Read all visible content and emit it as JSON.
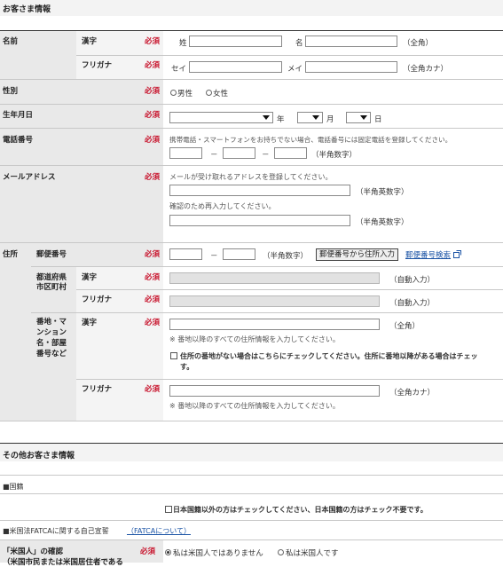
{
  "sections": {
    "customer_info": "お客さま情報",
    "other_info": "その他お客さま情報"
  },
  "required": "必須",
  "name": {
    "label": "名前",
    "kanji_label": "漢字",
    "kana_label": "フリガナ",
    "sei": "姓",
    "mei": "名",
    "sei_kana": "セイ",
    "mei_kana": "メイ",
    "kanji_hint": "（全角）",
    "kana_hint": "（全角カナ）"
  },
  "gender": {
    "label": "性別",
    "male": "男性",
    "female": "女性"
  },
  "birth": {
    "label": "生年月日",
    "year": "年",
    "month": "月",
    "day": "日"
  },
  "phone": {
    "label": "電話番号",
    "note": "携帯電話・スマートフォンをお持ちでない場合、電話番号には固定電話を登録してください。",
    "dash": "－",
    "hint": "（半角数字）"
  },
  "email": {
    "label": "メールアドレス",
    "note": "メールが受け取れるアドレスを登録してください。",
    "hint": "（半角英数字）",
    "confirm_note": "確認のため再入力してください。"
  },
  "address": {
    "label": "住所",
    "zip_label": "郵便番号",
    "zip_hint": "（半角数字）",
    "zip_button": "郵便番号から住所入力",
    "zip_search": "郵便番号検索",
    "pref_label_1": "都道府県",
    "pref_label_2": "市区町村",
    "auto": "（自動入力）",
    "street_label_1": "番地・マ",
    "street_label_2": "ンション",
    "street_label_3": "名・部屋",
    "street_label_4": "番号など",
    "street_note": "※ 番地以降のすべての住所情報を入力してください。",
    "no_number_1": "住所の番地がない場合はこちらにチェックしてください。住所に番地以降がある場合はチェッ",
    "no_number_2": "す。"
  },
  "nationality": {
    "header": "■国籍",
    "check": "日本国籍以外の方はチェックしてください、日本国籍の方はチェック不要です。"
  },
  "fatca": {
    "header": "■米国法FATCAに関する自己宣誓",
    "link": "（FATCAについて）",
    "q1": "「米国人」の確認",
    "q2": "（米国市民または米国居住者である",
    "opt_no": "私は米国人ではありません",
    "opt_yes": "私は米国人です"
  }
}
